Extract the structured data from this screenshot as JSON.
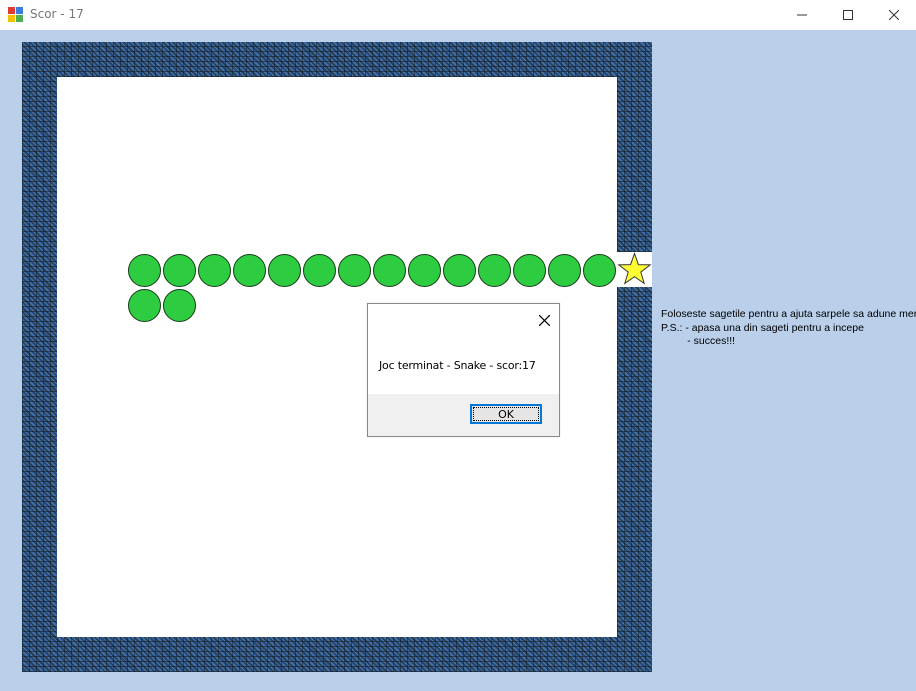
{
  "window": {
    "title": "Scor - 17",
    "controls": {
      "minimize": "—",
      "maximize": "☐",
      "close": "✕"
    }
  },
  "game": {
    "instructions": "Foloseste sagetile pentru a ajuta sarpele sa adune mer\nP.S.: - apasa una din sageti pentru a incepe\n         - succes!!!",
    "snake_segment_color": "#2ecc40",
    "food_color": "#ffff33",
    "food_icon": "star-icon"
  },
  "dialog": {
    "message": "Joc terminat - Snake - scor:17",
    "ok_label": "OK"
  }
}
